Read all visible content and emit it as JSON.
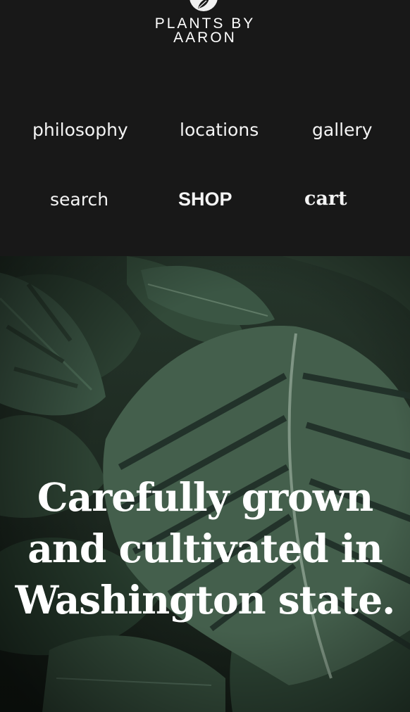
{
  "brand": {
    "line1": "PLANTS BY",
    "line2": "AARON",
    "icon": "leaf-icon"
  },
  "nav": {
    "philosophy": "philosophy",
    "locations": "locations",
    "gallery": "gallery",
    "search": "search",
    "shop": "SHOP",
    "cart": "cart"
  },
  "hero": {
    "heading": "Carefully grown and cultivated in Washington state.",
    "image": "monstera-leaves"
  },
  "colors": {
    "header_bg": "#181818",
    "text": "#ffffff",
    "leaf_green": "#3d5a46"
  }
}
